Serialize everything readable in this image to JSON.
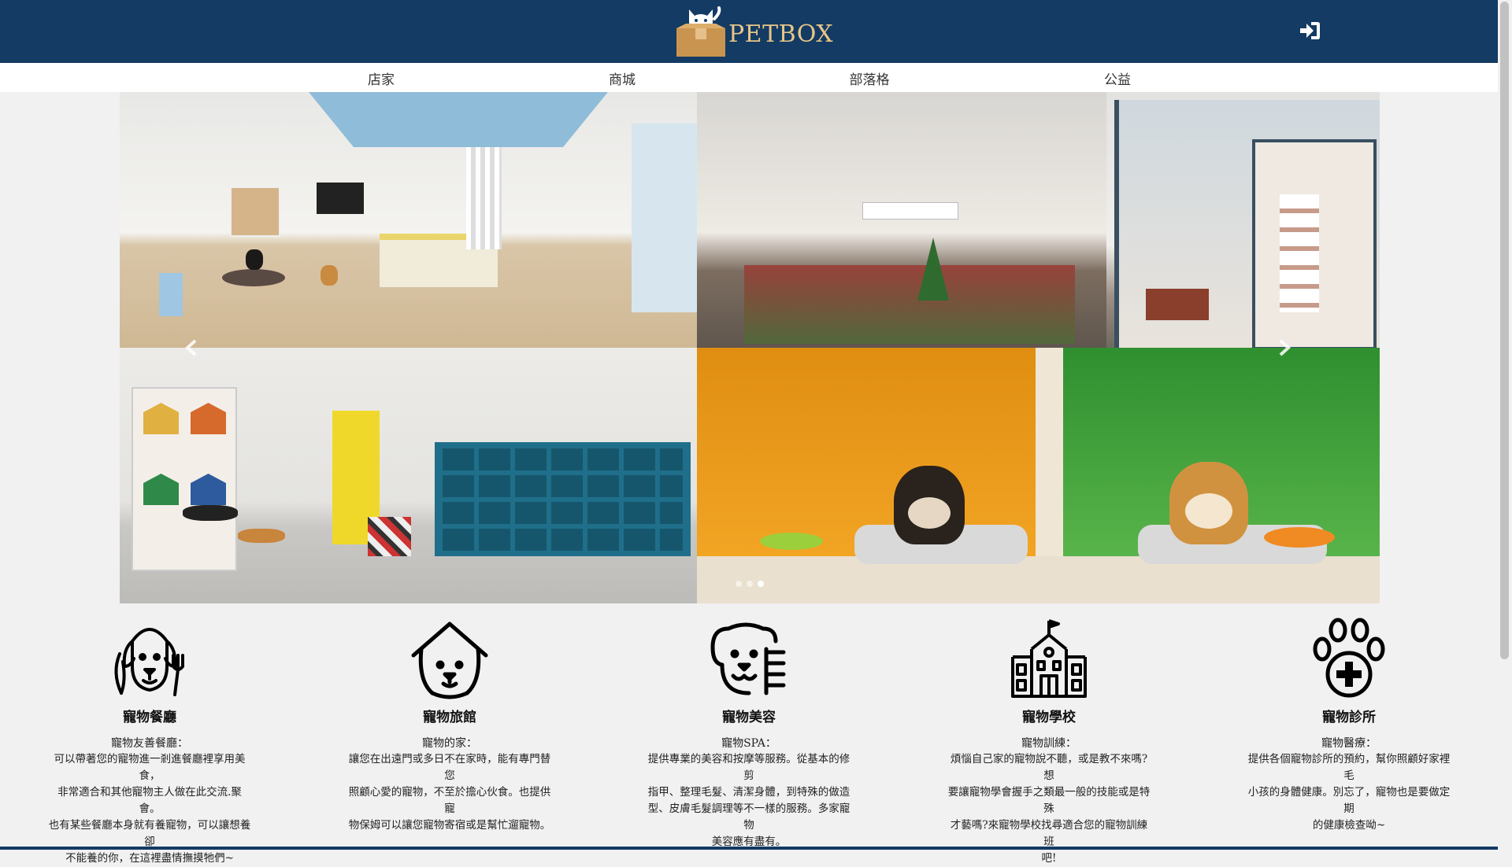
{
  "header": {
    "brand": "PETBOX",
    "login_icon": "sign-in-icon",
    "bg_color": "#133b63",
    "brand_color": "#e9c588"
  },
  "nav": {
    "items": [
      {
        "label": "店家"
      },
      {
        "label": "商城"
      },
      {
        "label": "部落格"
      },
      {
        "label": "公益"
      }
    ]
  },
  "carousel": {
    "prev_icon": "chevron-left-icon",
    "next_icon": "chevron-right-icon",
    "slides": 3,
    "active_index": 2
  },
  "services": [
    {
      "icon": "dog-fork-knife-icon",
      "title": "寵物餐廳",
      "subtitle": "寵物友善餐廳：",
      "lines": [
        "可以帶著您的寵物進一剎進餐廳裡享用美食，",
        "非常適合和其他寵物主人做在此交流.聚會。",
        "也有某些餐廳本身就有養寵物，可以讓想養卻",
        "不能養的你，在這裡盡情撫摸牠們~"
      ]
    },
    {
      "icon": "dog-house-icon",
      "title": "寵物旅館",
      "subtitle": "寵物的家：",
      "lines": [
        "讓您在出遠門或多日不在家時，能有專門替您",
        "照顧心愛的寵物，不至於擔心伙食。也提供寵",
        "物保姆可以讓您寵物寄宿或是幫忙遛寵物。"
      ]
    },
    {
      "icon": "dog-grooming-icon",
      "title": "寵物美容",
      "subtitle": "寵物SPA：",
      "lines": [
        "提供專業的美容和按摩等服務。從基本的修剪",
        "指甲、整理毛髮、清潔身體，到特殊的做造",
        "型、皮膚毛髮調理等不一樣的服務。多家寵物",
        "美容應有盡有。"
      ]
    },
    {
      "icon": "school-building-icon",
      "title": "寵物學校",
      "subtitle": "寵物訓練：",
      "lines": [
        "煩惱自己家的寵物說不聽，或是教不來嗎?想",
        "要讓寵物學會握手之類最一般的技能或是特殊",
        "才藝嗎?來寵物學校找尋適合您的寵物訓練班",
        "吧!"
      ]
    },
    {
      "icon": "paw-plus-icon",
      "title": "寵物診所",
      "subtitle": "寵物醫療：",
      "lines": [
        "提供各個寵物診所的預約，幫你照顧好家裡毛",
        "小孩的身體健康。別忘了，寵物也是要做定期",
        "的健康檢查呦~"
      ]
    }
  ]
}
